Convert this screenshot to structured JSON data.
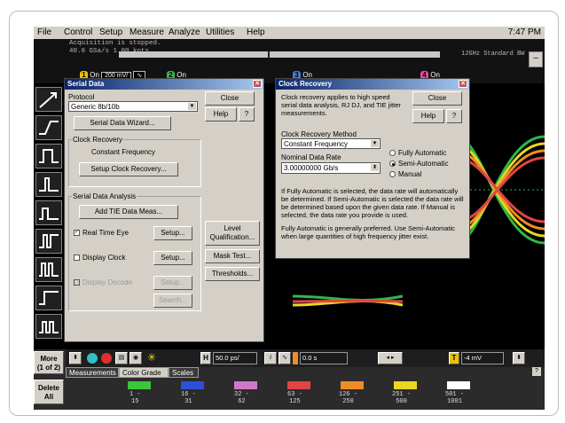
{
  "menu": {
    "items": [
      "File",
      "Control",
      "Setup",
      "Measure",
      "Analyze",
      "Utilities",
      "Help"
    ],
    "clock": "7:47 PM"
  },
  "status": {
    "line1": "Acquisition is stopped.",
    "line2": "40.0 GSa/s  1.00 kpts",
    "bandwidth": "12GHz Standard BW",
    "minimize": "–"
  },
  "channels": [
    {
      "num": "1",
      "on": "On",
      "value": "200 mV/",
      "color": "#e8c400"
    },
    {
      "num": "2",
      "on": "On",
      "color": "#2fb84a"
    },
    {
      "num": "3",
      "on": "On",
      "color": "#4a78e0"
    },
    {
      "num": "4",
      "on": "On",
      "color": "#e04da8"
    }
  ],
  "serial_dialog": {
    "title": "Serial Data",
    "protocol_label": "Protocol",
    "protocol_value": "Generic 8b/10b",
    "close": "Close",
    "help": "Help",
    "whats_this": "?",
    "wizard": "Serial Data Wizard...",
    "clock_recovery_label": "Clock Recovery",
    "clock_recovery_value": "Constant Frequency",
    "setup_clock": "Setup Clock Recovery...",
    "analysis_label": "Serial Data Analysis",
    "add_tie": "Add TIE Data Meas...",
    "real_time_eye": "Real Time Eye",
    "display_clock": "Display Clock",
    "display_decode": "Display Decode",
    "setup": "Setup...",
    "search": "Search...",
    "level_qual": "Level\nQualification...",
    "mask_test": "Mask Test...",
    "thresholds": "Thresholds..."
  },
  "clock_dialog": {
    "title": "Clock Recovery",
    "description": "Clock recovery applies to high speed serial data analysis, RJ DJ, and TIE jitter measurements.",
    "close": "Close",
    "help": "Help",
    "whats_this": "?",
    "method_label": "Clock Recovery Method",
    "method_value": "Constant Frequency",
    "rate_label": "Nominal Data Rate",
    "rate_value": "3.00000000 Gb/s",
    "radio_options": [
      "Fully Automatic",
      "Semi-Automatic",
      "Manual"
    ],
    "radio_selected": 1,
    "info1": "If Fully Automatic is selected, the data rate will automatically be determined. If Semi-Automatic is selected the data rate will be determined based upon the given data rate. If Manual is selected, the data rate you provide is used.",
    "info2": "Fully Automatic is generally preferred. Use Semi-Automatic when large quantities of high frequency jitter exist."
  },
  "bottom": {
    "more": "More\n(1 of 2)",
    "delete": "Delete\nAll",
    "timebase": "50.0 ps/",
    "delay": "0.0 s",
    "trigger_level": "-4 mV",
    "tabs": [
      "Measurements",
      "Color Grade",
      "Scales"
    ],
    "active_tab": 1,
    "help": "?",
    "color_grades": [
      {
        "color": "#3cc43c",
        "range": "1 -\n15"
      },
      {
        "color": "#2e50d8",
        "range": "16 -\n31"
      },
      {
        "color": "#d078c8",
        "range": "32 -\n62"
      },
      {
        "color": "#e04444",
        "range": "63 -\n125"
      },
      {
        "color": "#f08c28",
        "range": "126 -\n250"
      },
      {
        "color": "#e8d820",
        "range": "251 -\n500"
      },
      {
        "color": "#ffffff",
        "range": "501 -\n1001"
      }
    ]
  }
}
